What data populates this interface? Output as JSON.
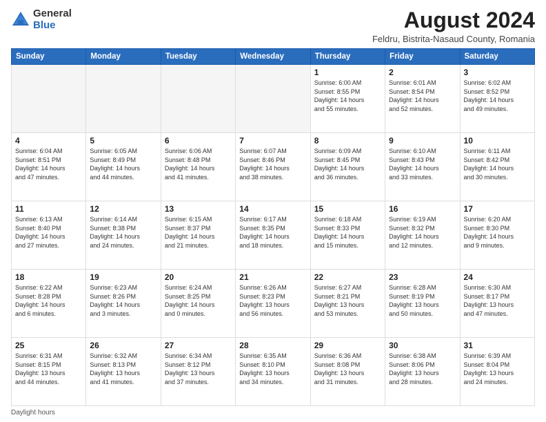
{
  "logo": {
    "general": "General",
    "blue": "Blue"
  },
  "title": "August 2024",
  "subtitle": "Feldru, Bistrita-Nasaud County, Romania",
  "days_of_week": [
    "Sunday",
    "Monday",
    "Tuesday",
    "Wednesday",
    "Thursday",
    "Friday",
    "Saturday"
  ],
  "weeks": [
    [
      {
        "day": "",
        "info": ""
      },
      {
        "day": "",
        "info": ""
      },
      {
        "day": "",
        "info": ""
      },
      {
        "day": "",
        "info": ""
      },
      {
        "day": "1",
        "info": "Sunrise: 6:00 AM\nSunset: 8:55 PM\nDaylight: 14 hours\nand 55 minutes."
      },
      {
        "day": "2",
        "info": "Sunrise: 6:01 AM\nSunset: 8:54 PM\nDaylight: 14 hours\nand 52 minutes."
      },
      {
        "day": "3",
        "info": "Sunrise: 6:02 AM\nSunset: 8:52 PM\nDaylight: 14 hours\nand 49 minutes."
      }
    ],
    [
      {
        "day": "4",
        "info": "Sunrise: 6:04 AM\nSunset: 8:51 PM\nDaylight: 14 hours\nand 47 minutes."
      },
      {
        "day": "5",
        "info": "Sunrise: 6:05 AM\nSunset: 8:49 PM\nDaylight: 14 hours\nand 44 minutes."
      },
      {
        "day": "6",
        "info": "Sunrise: 6:06 AM\nSunset: 8:48 PM\nDaylight: 14 hours\nand 41 minutes."
      },
      {
        "day": "7",
        "info": "Sunrise: 6:07 AM\nSunset: 8:46 PM\nDaylight: 14 hours\nand 38 minutes."
      },
      {
        "day": "8",
        "info": "Sunrise: 6:09 AM\nSunset: 8:45 PM\nDaylight: 14 hours\nand 36 minutes."
      },
      {
        "day": "9",
        "info": "Sunrise: 6:10 AM\nSunset: 8:43 PM\nDaylight: 14 hours\nand 33 minutes."
      },
      {
        "day": "10",
        "info": "Sunrise: 6:11 AM\nSunset: 8:42 PM\nDaylight: 14 hours\nand 30 minutes."
      }
    ],
    [
      {
        "day": "11",
        "info": "Sunrise: 6:13 AM\nSunset: 8:40 PM\nDaylight: 14 hours\nand 27 minutes."
      },
      {
        "day": "12",
        "info": "Sunrise: 6:14 AM\nSunset: 8:38 PM\nDaylight: 14 hours\nand 24 minutes."
      },
      {
        "day": "13",
        "info": "Sunrise: 6:15 AM\nSunset: 8:37 PM\nDaylight: 14 hours\nand 21 minutes."
      },
      {
        "day": "14",
        "info": "Sunrise: 6:17 AM\nSunset: 8:35 PM\nDaylight: 14 hours\nand 18 minutes."
      },
      {
        "day": "15",
        "info": "Sunrise: 6:18 AM\nSunset: 8:33 PM\nDaylight: 14 hours\nand 15 minutes."
      },
      {
        "day": "16",
        "info": "Sunrise: 6:19 AM\nSunset: 8:32 PM\nDaylight: 14 hours\nand 12 minutes."
      },
      {
        "day": "17",
        "info": "Sunrise: 6:20 AM\nSunset: 8:30 PM\nDaylight: 14 hours\nand 9 minutes."
      }
    ],
    [
      {
        "day": "18",
        "info": "Sunrise: 6:22 AM\nSunset: 8:28 PM\nDaylight: 14 hours\nand 6 minutes."
      },
      {
        "day": "19",
        "info": "Sunrise: 6:23 AM\nSunset: 8:26 PM\nDaylight: 14 hours\nand 3 minutes."
      },
      {
        "day": "20",
        "info": "Sunrise: 6:24 AM\nSunset: 8:25 PM\nDaylight: 14 hours\nand 0 minutes."
      },
      {
        "day": "21",
        "info": "Sunrise: 6:26 AM\nSunset: 8:23 PM\nDaylight: 13 hours\nand 56 minutes."
      },
      {
        "day": "22",
        "info": "Sunrise: 6:27 AM\nSunset: 8:21 PM\nDaylight: 13 hours\nand 53 minutes."
      },
      {
        "day": "23",
        "info": "Sunrise: 6:28 AM\nSunset: 8:19 PM\nDaylight: 13 hours\nand 50 minutes."
      },
      {
        "day": "24",
        "info": "Sunrise: 6:30 AM\nSunset: 8:17 PM\nDaylight: 13 hours\nand 47 minutes."
      }
    ],
    [
      {
        "day": "25",
        "info": "Sunrise: 6:31 AM\nSunset: 8:15 PM\nDaylight: 13 hours\nand 44 minutes."
      },
      {
        "day": "26",
        "info": "Sunrise: 6:32 AM\nSunset: 8:13 PM\nDaylight: 13 hours\nand 41 minutes."
      },
      {
        "day": "27",
        "info": "Sunrise: 6:34 AM\nSunset: 8:12 PM\nDaylight: 13 hours\nand 37 minutes."
      },
      {
        "day": "28",
        "info": "Sunrise: 6:35 AM\nSunset: 8:10 PM\nDaylight: 13 hours\nand 34 minutes."
      },
      {
        "day": "29",
        "info": "Sunrise: 6:36 AM\nSunset: 8:08 PM\nDaylight: 13 hours\nand 31 minutes."
      },
      {
        "day": "30",
        "info": "Sunrise: 6:38 AM\nSunset: 8:06 PM\nDaylight: 13 hours\nand 28 minutes."
      },
      {
        "day": "31",
        "info": "Sunrise: 6:39 AM\nSunset: 8:04 PM\nDaylight: 13 hours\nand 24 minutes."
      }
    ]
  ],
  "footer": "Daylight hours"
}
